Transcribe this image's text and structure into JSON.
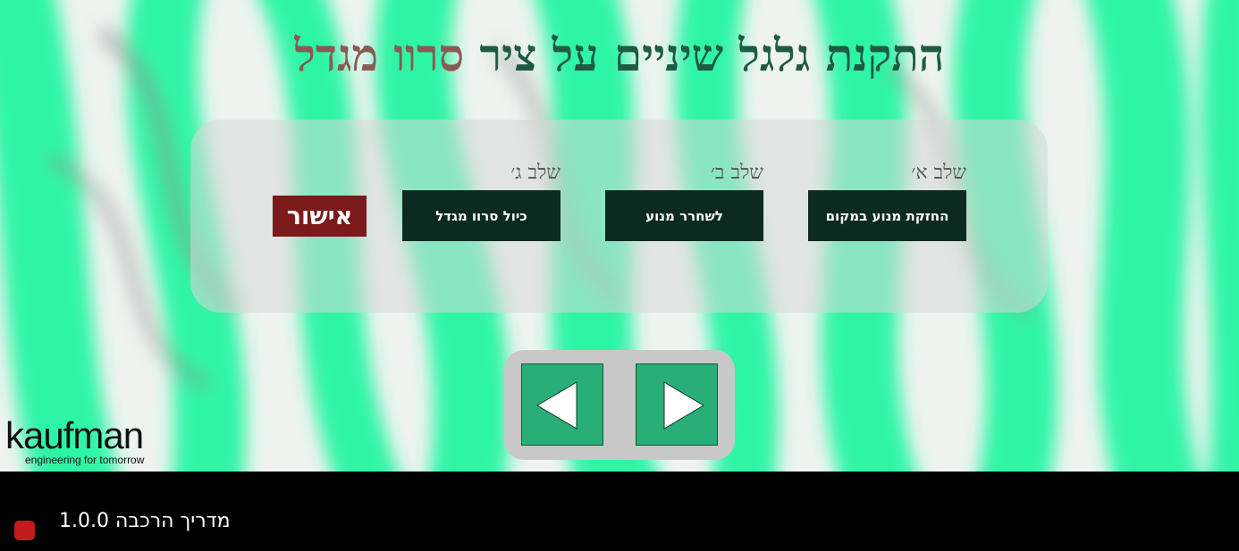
{
  "title": {
    "main": "התקנת גלגל שיניים על ציר",
    "accent": "סרוו מגדל"
  },
  "steps": [
    {
      "label": "שלב א׳",
      "button": "החזקת מנוע במקום"
    },
    {
      "label": "שלב ב׳",
      "button": "לשחרר מנוע"
    },
    {
      "label": "שלב ג׳",
      "button": "כיול סרוו מגדל"
    }
  ],
  "confirm_label": "אישור",
  "nav": {
    "prev_icon": "triangle-left-icon",
    "next_icon": "triangle-right-icon"
  },
  "logo": {
    "word": "kaufman",
    "tagline": "engineering for tomorrow"
  },
  "footer": {
    "app_title": "מדריך הרכבה 1.0.0"
  },
  "colors": {
    "step_button": "#0d2a21",
    "confirm_button": "#7b1a1a",
    "nav_button": "#2aae77",
    "title_main": "#1f5a43",
    "title_accent": "#8a5a52",
    "background_green": "#2ef5a6",
    "record": "#c21b1b"
  }
}
